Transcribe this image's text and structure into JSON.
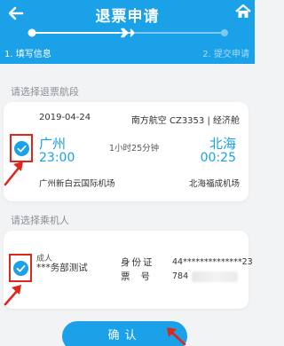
{
  "header": {
    "title": "退票申请",
    "back_icon": "arrow-left-icon",
    "home_icon": "home-icon",
    "bg_color": "#1aa1e8"
  },
  "steps": {
    "step1": "1. 填写信息",
    "step2": "2. 提交申请",
    "current": 1
  },
  "flight_section": {
    "label": "请选择退票航段",
    "flight": {
      "date": "2019-04-24",
      "airline": "南方航空 CZ3353 | 经济舱",
      "departure_city": "广州",
      "departure_time": "23:00",
      "arrival_city": "北海",
      "arrival_time": "00:25",
      "duration": "1小时25分钟",
      "departure_airport": "广州新白云国际机场",
      "arrival_airport": "北海福成机场",
      "selected": true
    }
  },
  "passenger_section": {
    "label": "请选择乘机人",
    "passenger": {
      "type": "成人",
      "name": "***务部测试",
      "id_label": "身份证",
      "id_value": "44**************23",
      "ticket_label": "票号",
      "ticket_value": "784",
      "selected": true
    }
  },
  "confirm_button": {
    "label": "确认"
  },
  "colors": {
    "accent": "#1aa1e8",
    "annotation": "#e0251b"
  }
}
